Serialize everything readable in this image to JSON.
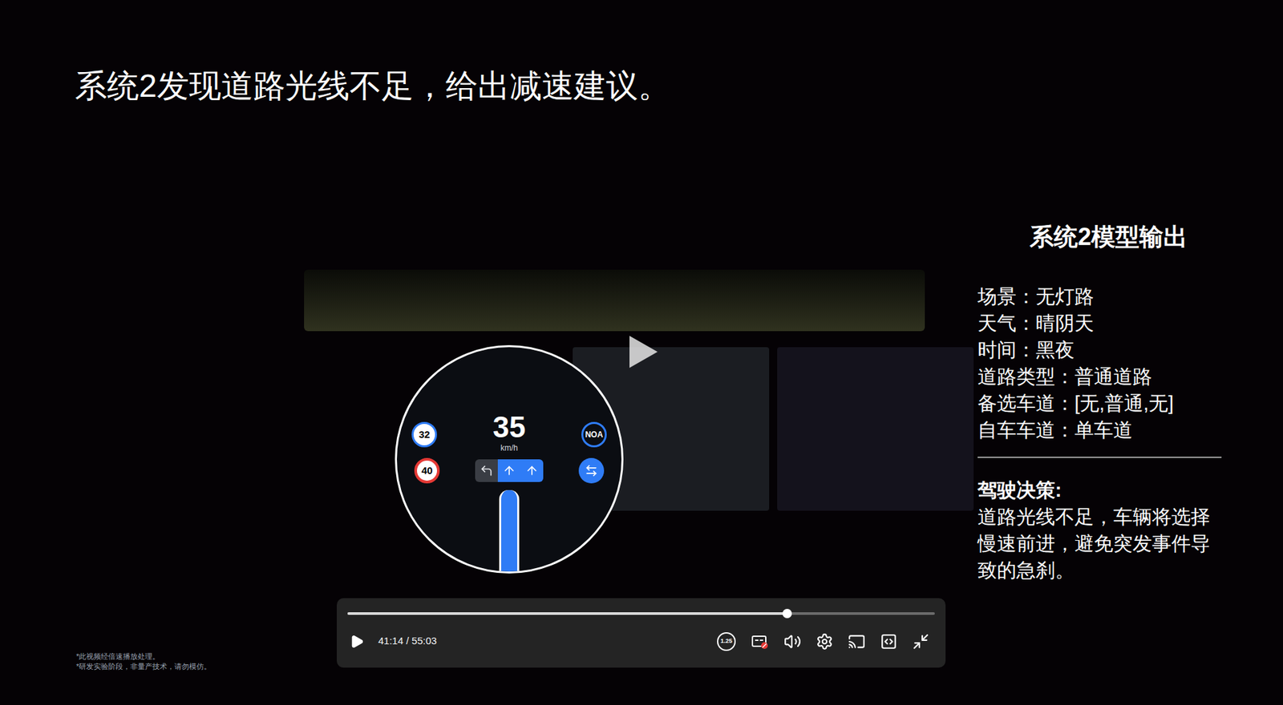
{
  "video": {
    "caption": "系统2发现道路光线不足，给出减速建议。",
    "footnotes": [
      "*此视频经倍速播放处理。",
      "*研发实验阶段，非量产技术，请勿模仿。"
    ]
  },
  "model_output": {
    "title": "系统2模型输出",
    "fields": [
      {
        "label": "场景：",
        "value": "无灯路"
      },
      {
        "label": "天气：",
        "value": "晴阴天"
      },
      {
        "label": "时间：",
        "value": "黑夜"
      },
      {
        "label": "道路类型：",
        "value": "普通道路"
      },
      {
        "label": "备选车道：",
        "value": "[无,普通,无]"
      },
      {
        "label": "自车车道：",
        "value": "单车道"
      }
    ],
    "decision_label": "驾驶决策:",
    "decision_lines": [
      "道路光线不足，车辆将选择",
      "慢速前进，避免突发事件导",
      "致的急刹。"
    ]
  },
  "dashboard": {
    "speed": "35",
    "unit": "km/h",
    "current_limit": "32",
    "speed_limit": "40",
    "mode": "NOA",
    "lanes": [
      {
        "kind": "left",
        "selected": false
      },
      {
        "kind": "straight",
        "selected": true
      },
      {
        "kind": "straight",
        "selected": true
      }
    ]
  },
  "player": {
    "playing": false,
    "time": "41:14 / 55:03",
    "level": 0.749,
    "playback_speed": "1.25",
    "captions_on": false
  }
}
